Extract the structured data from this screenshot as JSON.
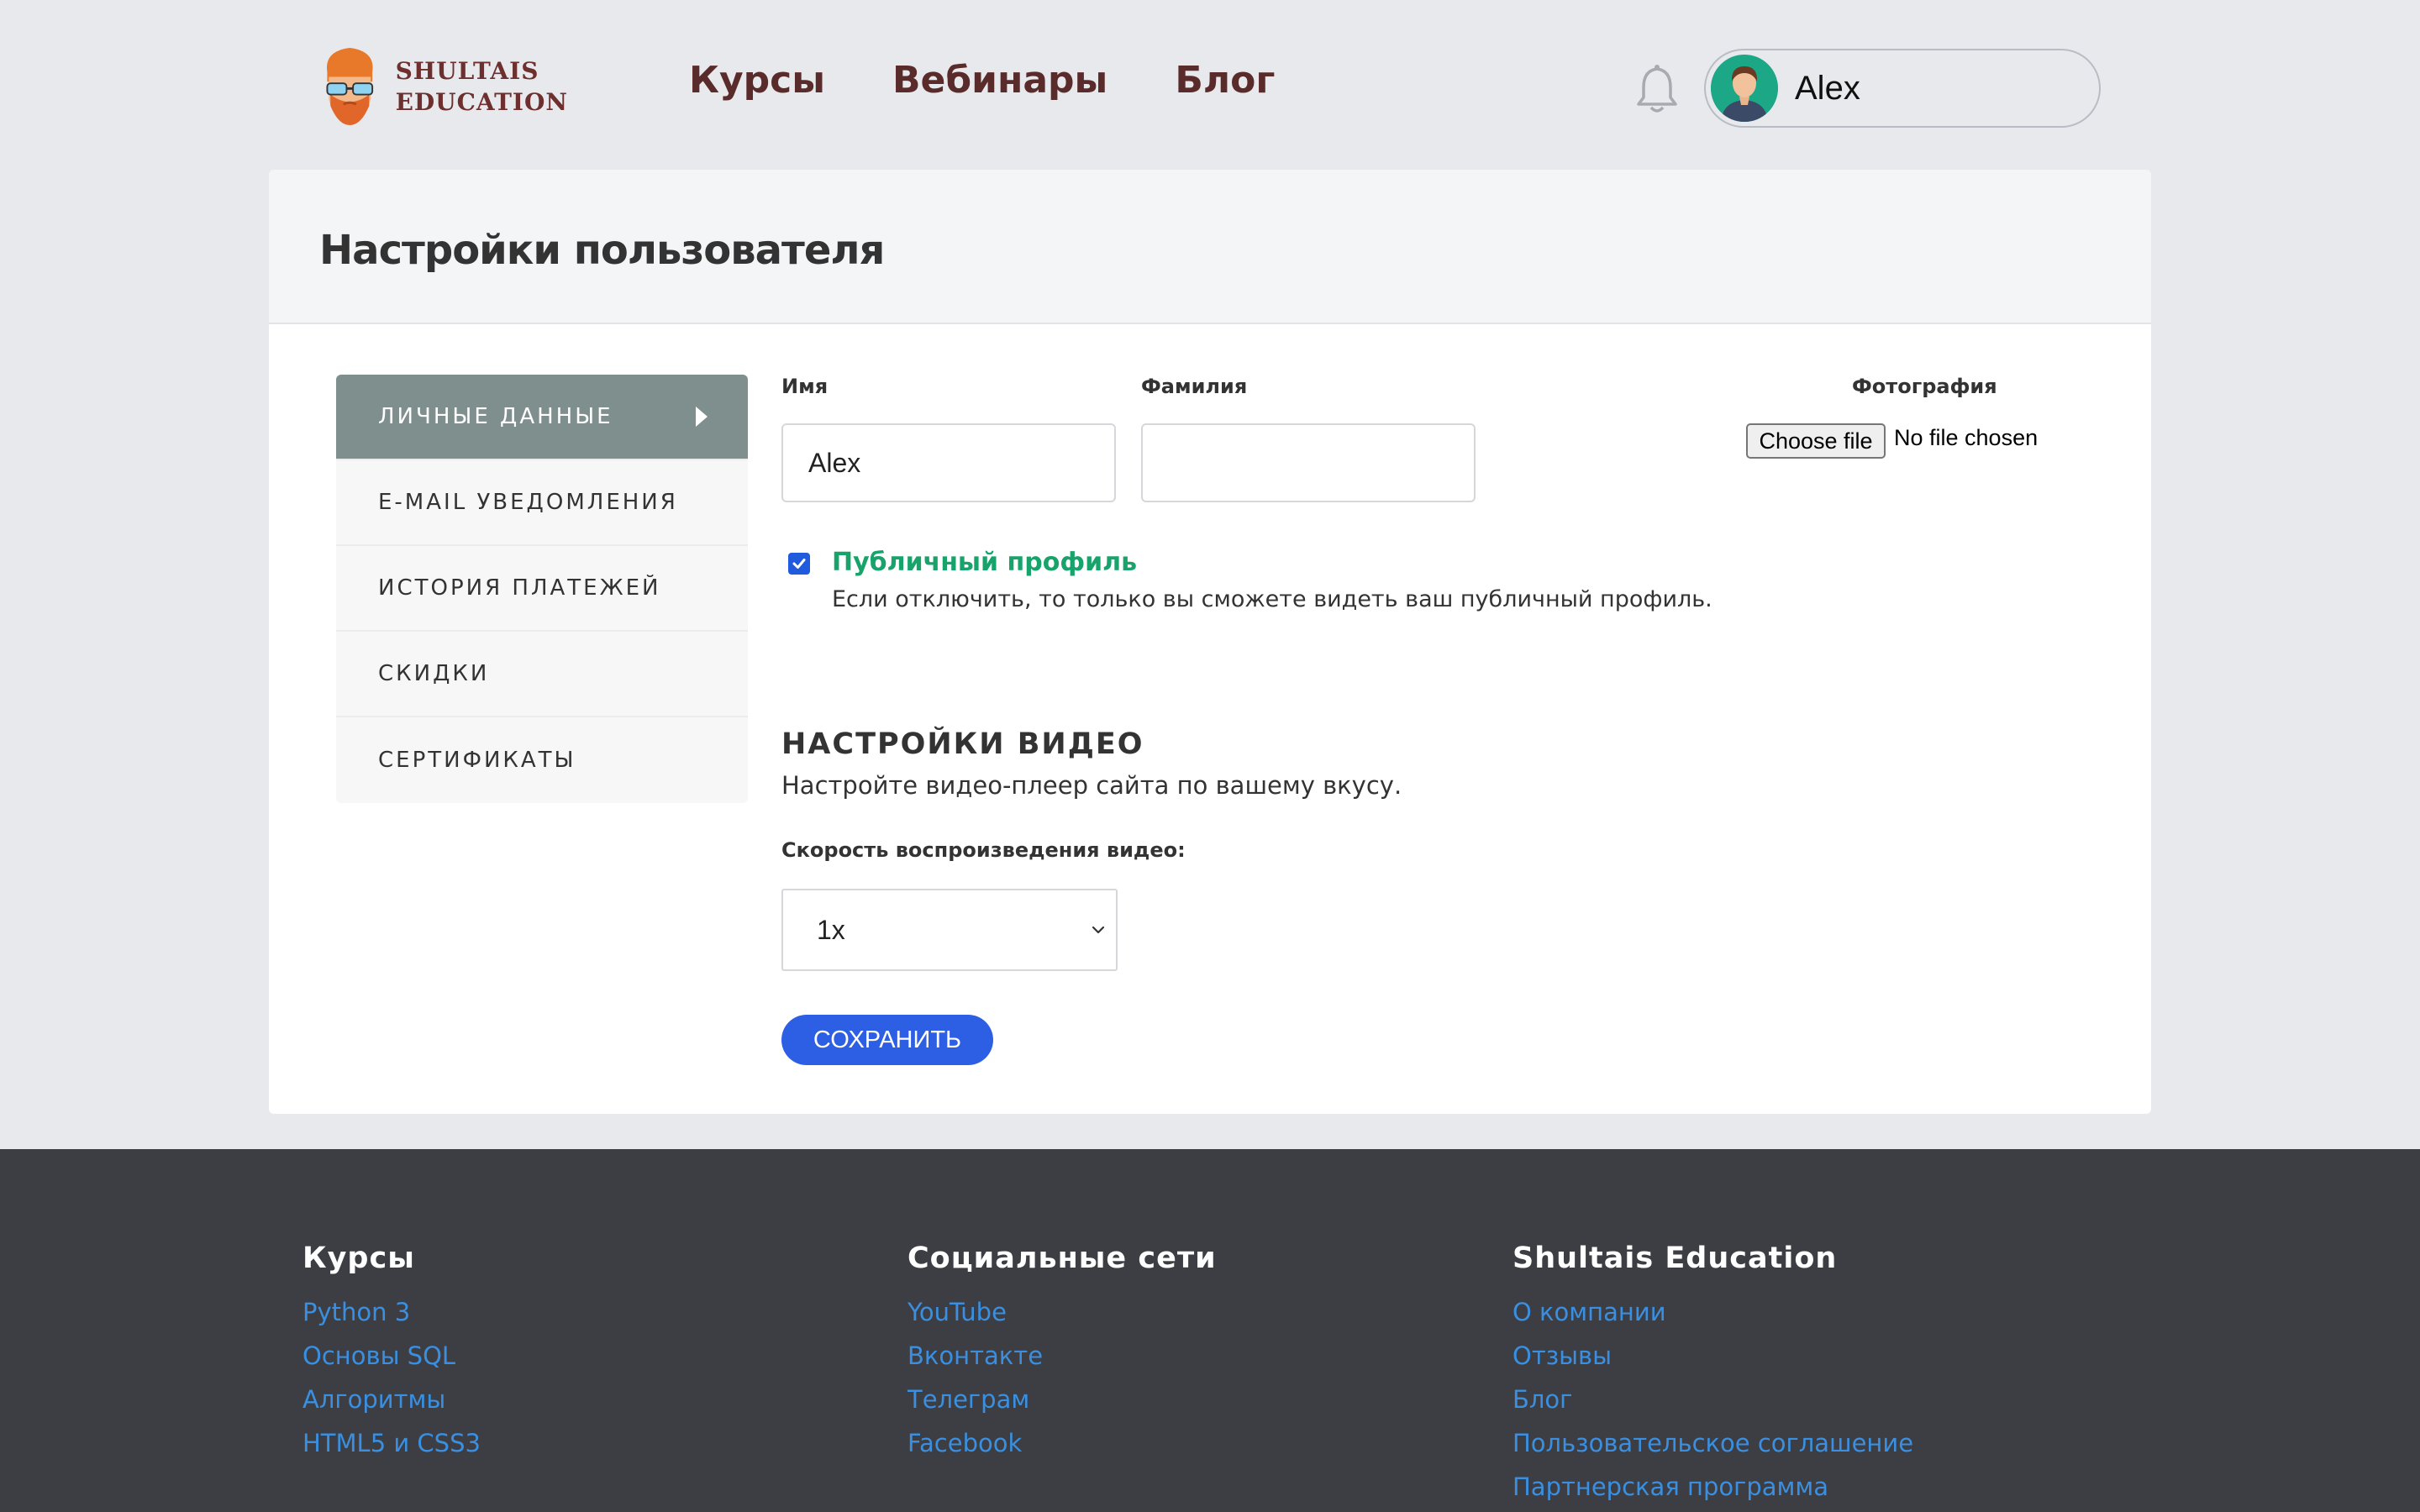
{
  "header": {
    "logo_line1": "SHULTAIS",
    "logo_line2": "EDUCATION",
    "nav": [
      "Курсы",
      "Вебинары",
      "Блог"
    ],
    "user_name": "Alex"
  },
  "page": {
    "title": "Настройки пользователя"
  },
  "sidebar": {
    "items": [
      {
        "label": "ЛИЧНЫЕ ДАННЫЕ",
        "active": true
      },
      {
        "label": "E-MAIL УВЕДОМЛЕНИЯ",
        "active": false
      },
      {
        "label": "ИСТОРИЯ ПЛАТЕЖЕЙ",
        "active": false
      },
      {
        "label": "СКИДКИ",
        "active": false
      },
      {
        "label": "СЕРТИФИКАТЫ",
        "active": false
      }
    ]
  },
  "form": {
    "first_name_label": "Имя",
    "first_name_value": "Alex",
    "last_name_label": "Фамилия",
    "last_name_value": "",
    "photo_label": "Фотография",
    "file_button": "Choose file",
    "file_status": "No file chosen",
    "public_profile_label": "Публичный профиль",
    "public_profile_checked": true,
    "public_profile_help": "Если отключить, то только вы сможете видеть ваш публичный профиль."
  },
  "video": {
    "title": "НАСТРОЙКИ ВИДЕО",
    "subtitle": "Настройте видео-плеер сайта по вашему вкусу.",
    "speed_label": "Скорость воспроизведения видео:",
    "speed_value": "1x"
  },
  "save_button": "СОХРАНИТЬ",
  "footer": {
    "columns": [
      {
        "title": "Курсы",
        "links": [
          "Python 3",
          "Основы SQL",
          "Алгоритмы",
          "HTML5 и CSS3"
        ]
      },
      {
        "title": "Социальные сети",
        "links": [
          "YouTube",
          "Вконтакте",
          "Телеграм",
          "Facebook"
        ]
      },
      {
        "title": "Shultais Education",
        "links": [
          "О компании",
          "Отзывы",
          "Блог",
          "Пользовательское соглашение",
          "Партнерская программа"
        ]
      }
    ]
  },
  "colors": {
    "nav_text": "#5a2b2b",
    "active_tab": "#7f8f8d",
    "accent_blue": "#2c5fe4",
    "public_green": "#17a36a",
    "footer_bg": "#3d3e43",
    "footer_link": "#3a8fe0"
  },
  "icons": {
    "bell": "bell-icon",
    "avatar": "user-avatar",
    "arrow": "caret-right-icon",
    "chevron": "chevron-down-icon",
    "check": "checkmark-icon"
  }
}
